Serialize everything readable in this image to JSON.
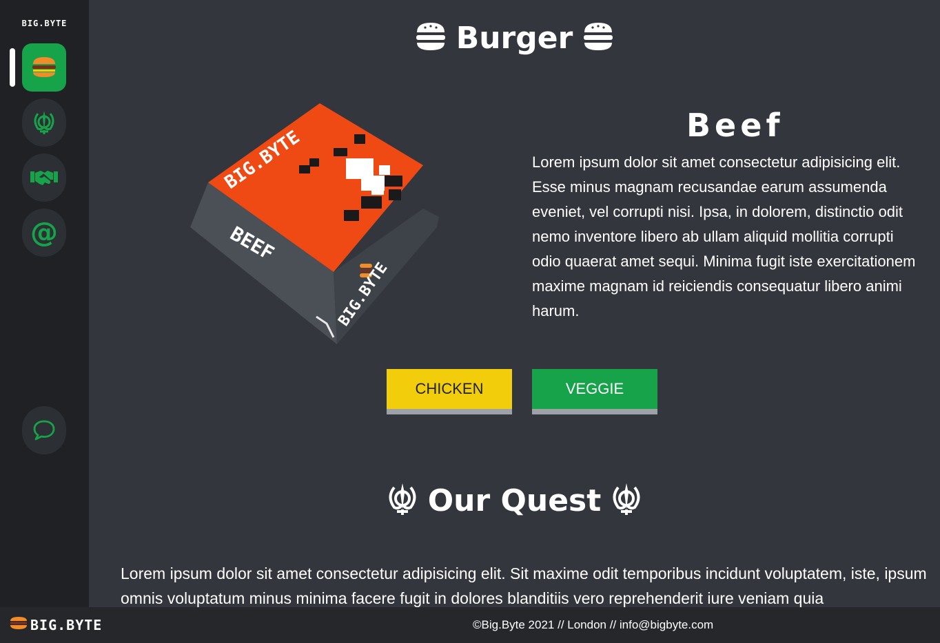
{
  "sidebar": {
    "logo": "BIG.BYTE",
    "nav": [
      {
        "icon": "burger-icon",
        "active": true
      },
      {
        "icon": "khanda-icon",
        "active": false
      },
      {
        "icon": "handshake-icon",
        "active": false
      },
      {
        "icon": "at-icon",
        "active": false
      }
    ],
    "chat_icon": "chat-bubble-icon",
    "at_glyph": "@"
  },
  "burger_section": {
    "title": "Burger",
    "product": {
      "name": "Beef",
      "description": "Lorem ipsum dolor sit amet consectetur adipisicing elit. Esse minus magnam recusandae earum assumenda eveniet, vel corrupti nisi. Ipsa, in dolorem, distinctio odit nemo inventore libero ab ullam aliquid mollitia corrupti odio quaerat amet sequi. Minima fugit iste exercitationem maxime magnam id reiciendis consequatur libero animi harum.",
      "box_brand_text": "BIG.BYTE",
      "box_side_text": "BEEF"
    },
    "buttons": {
      "chicken": "CHICKEN",
      "veggie": "VEGGIE"
    }
  },
  "quest_section": {
    "title": "Our Quest",
    "text": "Lorem ipsum dolor sit amet consectetur adipisicing elit. Sit maxime odit temporibus incidunt voluptatem, iste, ipsum omnis voluptatum minus minima facere fugit in dolores blanditiis vero reprehenderit iure veniam quia"
  },
  "footer": {
    "logo": "BIG.BYTE",
    "info": "©Big.Byte 2021 // London // info@bigbyte.com"
  },
  "colors": {
    "accent_green": "#16a34a",
    "chicken_yellow": "#f2cd0b",
    "background": "#34363d",
    "sidebar": "#1f2124",
    "box_orange": "#f04a14"
  }
}
